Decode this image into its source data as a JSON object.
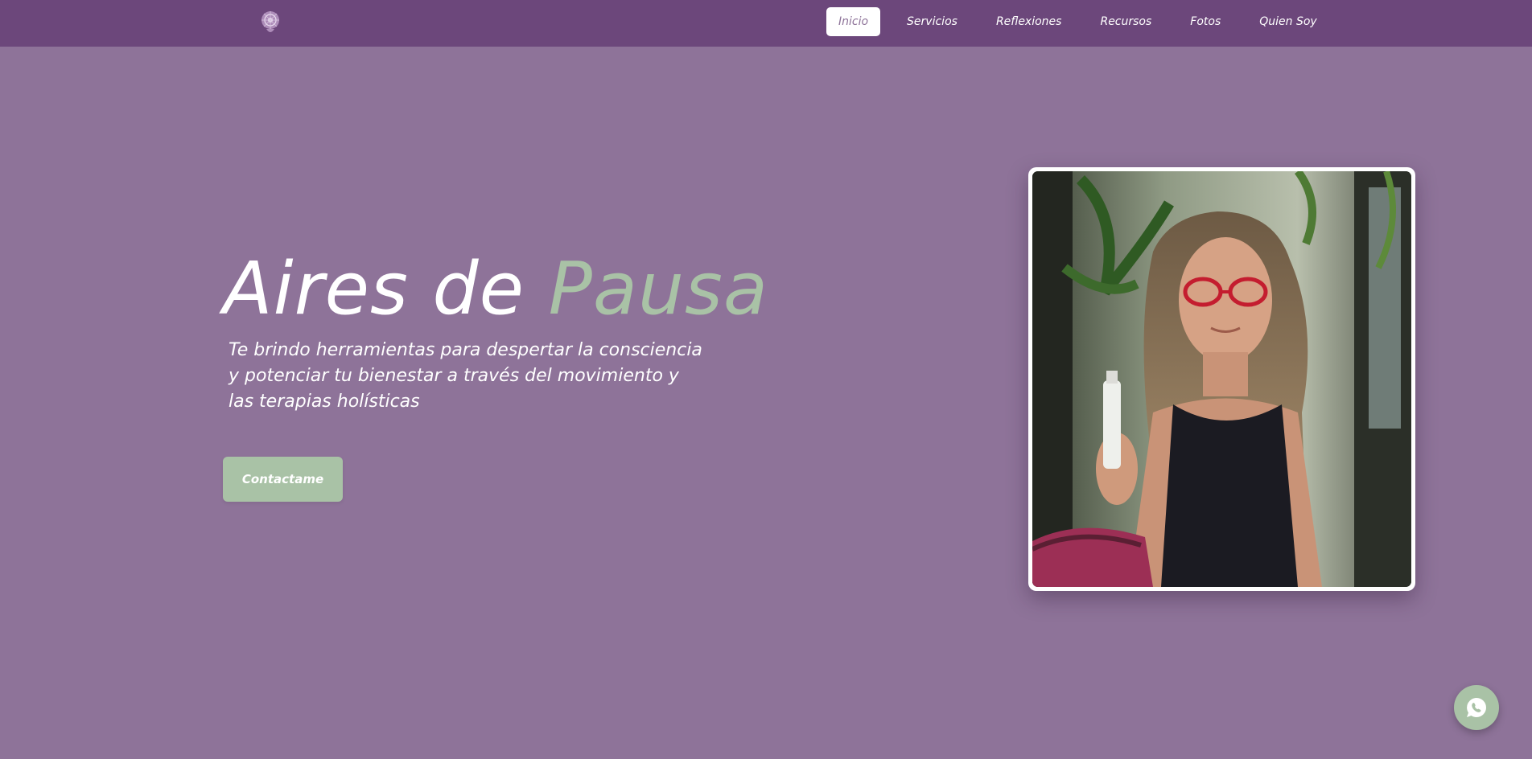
{
  "nav": {
    "logo_icon": "mandala-logo-icon",
    "items": [
      {
        "label": "Inicio",
        "active": true
      },
      {
        "label": "Servicios",
        "active": false
      },
      {
        "label": "Reflexiones",
        "active": false
      },
      {
        "label": "Recursos",
        "active": false
      },
      {
        "label": "Fotos",
        "active": false
      },
      {
        "label": "Quien Soy",
        "active": false
      }
    ]
  },
  "hero": {
    "title_part1": "Aires de ",
    "title_part2": "Pausa",
    "subtitle": "Te brindo herramientas para despertar la consciencia y potenciar tu bienestar a través del movimiento y las terapias holísticas",
    "cta_label": "Contactame",
    "photo_icon": "portrait-photo"
  },
  "float": {
    "whatsapp_icon": "whatsapp-icon"
  },
  "colors": {
    "nav_bg": "#6c477b",
    "page_bg": "#8e7399",
    "accent_green": "#a9c2a6",
    "white": "#ffffff"
  }
}
